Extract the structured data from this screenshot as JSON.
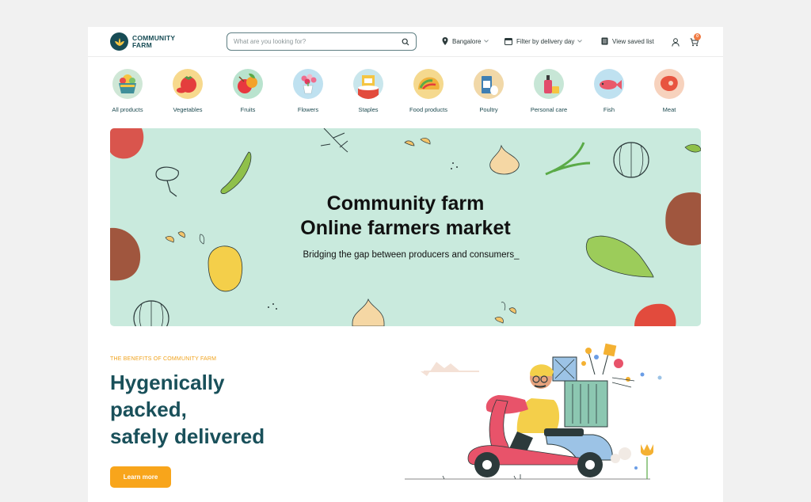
{
  "brand": {
    "line1": "COMMUNITY",
    "line2": "FARM"
  },
  "search": {
    "placeholder": "What are you looking for?"
  },
  "header": {
    "location": "Bangalore",
    "filter_label": "Filter by delivery day",
    "saved_label": "View saved list",
    "cart_count": "0"
  },
  "categories": [
    {
      "label": "All products",
      "icon": "basket-icon"
    },
    {
      "label": "Vegetables",
      "icon": "tomato-icon"
    },
    {
      "label": "Fruits",
      "icon": "fruit-icon"
    },
    {
      "label": "Flowers",
      "icon": "flower-icon"
    },
    {
      "label": "Staples",
      "icon": "flour-bag-icon"
    },
    {
      "label": "Food products",
      "icon": "taco-icon"
    },
    {
      "label": "Poultry",
      "icon": "milk-icon"
    },
    {
      "label": "Personal care",
      "icon": "bottle-icon"
    },
    {
      "label": "Fish",
      "icon": "fish-icon"
    },
    {
      "label": "Meat",
      "icon": "meat-icon"
    }
  ],
  "hero": {
    "title_line1": "Community farm",
    "title_line2": "Online farmers market",
    "subtitle": "Bridging the gap between producers and consumers_"
  },
  "benefits": {
    "eyebrow": "THE BENEFITS OF COMMUNITY FARM",
    "line1": "Hygenically",
    "line2": "packed,",
    "line3": "safely delivered",
    "cta": "Learn more"
  },
  "colors": {
    "brand": "#174c55",
    "accent": "#f8a51b",
    "hero_bg": "#c9eadd",
    "cart_badge": "#f07c45"
  }
}
